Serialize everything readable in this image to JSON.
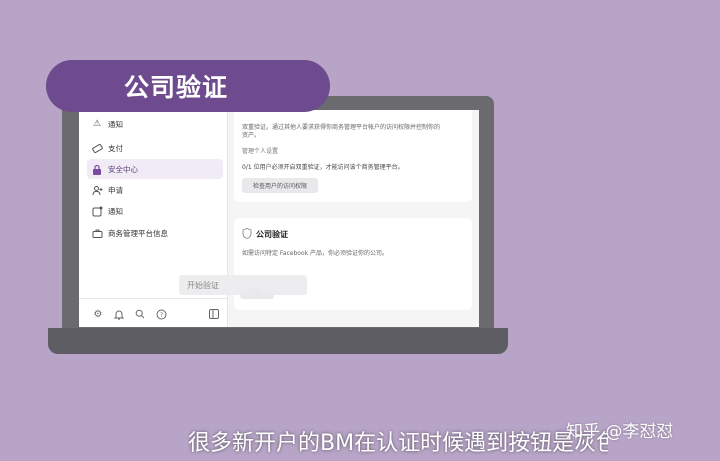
{
  "overlay": {
    "title": "公司验证",
    "subtitle": "很多新开户的BM在认证时候遇到按钮是灰色",
    "watermark": "知乎 @李怼怼"
  },
  "sidebar": {
    "items": [
      {
        "label": "通知",
        "icon": "truncated-icon"
      },
      {
        "label": "支付",
        "icon": "card-icon"
      },
      {
        "label": "安全中心",
        "icon": "lock-icon"
      },
      {
        "label": "申请",
        "icon": "person-add-icon"
      },
      {
        "label": "通知",
        "icon": "notification-icon"
      },
      {
        "label": "商务管理平台信息",
        "icon": "briefcase-icon"
      }
    ],
    "footer_icons": [
      "gear-icon",
      "bell-icon",
      "search-icon",
      "help-icon",
      "panel-icon"
    ]
  },
  "card1": {
    "desc_line1": "双重验证。通过其他人要求获得你商务管理平台帐户的访问权限并控制你的",
    "desc_line2": "资产。",
    "manage_link": "管理个人设置",
    "status_text": "0/1 位用户必须开启双重验证，才能访问该个商务管理平台。",
    "button_label": "检查用户的访问权限"
  },
  "card2": {
    "title": "公司验证",
    "desc": "如需访问特定 Facebook 产品，你必须验证你的公司。",
    "button_label": "开始..."
  },
  "tooltip": {
    "label": "开始验证"
  }
}
